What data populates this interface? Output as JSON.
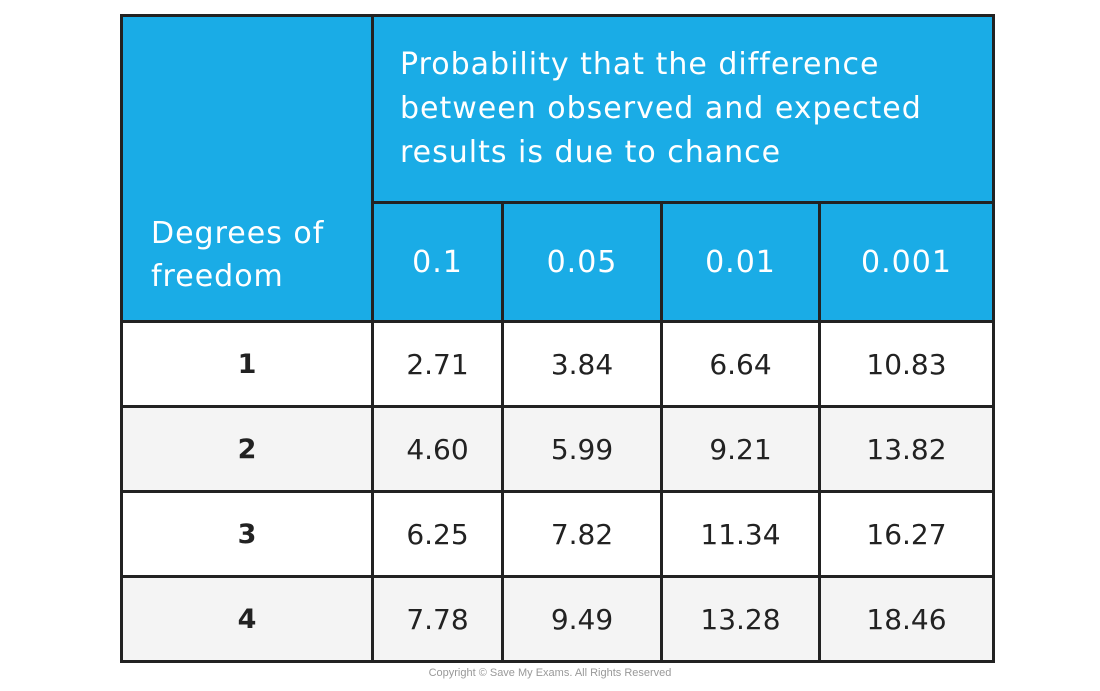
{
  "table": {
    "header": {
      "row_label": "Degrees of freedom",
      "group_label": "Probability that the difference between observed and expected results is due to chance",
      "probabilities": [
        "0.1",
        "0.05",
        "0.01",
        "0.001"
      ]
    },
    "rows": [
      {
        "df": "1",
        "values": [
          "2.71",
          "3.84",
          "6.64",
          "10.83"
        ]
      },
      {
        "df": "2",
        "values": [
          "4.60",
          "5.99",
          "9.21",
          "13.82"
        ]
      },
      {
        "df": "3",
        "values": [
          "6.25",
          "7.82",
          "11.34",
          "16.27"
        ]
      },
      {
        "df": "4",
        "values": [
          "7.78",
          "9.49",
          "13.28",
          "18.46"
        ]
      }
    ]
  },
  "colors": {
    "header_bg": "#1aace6",
    "border": "#222222",
    "alt_row": "#f4f4f4"
  },
  "copyright": "Copyright © Save My Exams. All Rights Reserved"
}
